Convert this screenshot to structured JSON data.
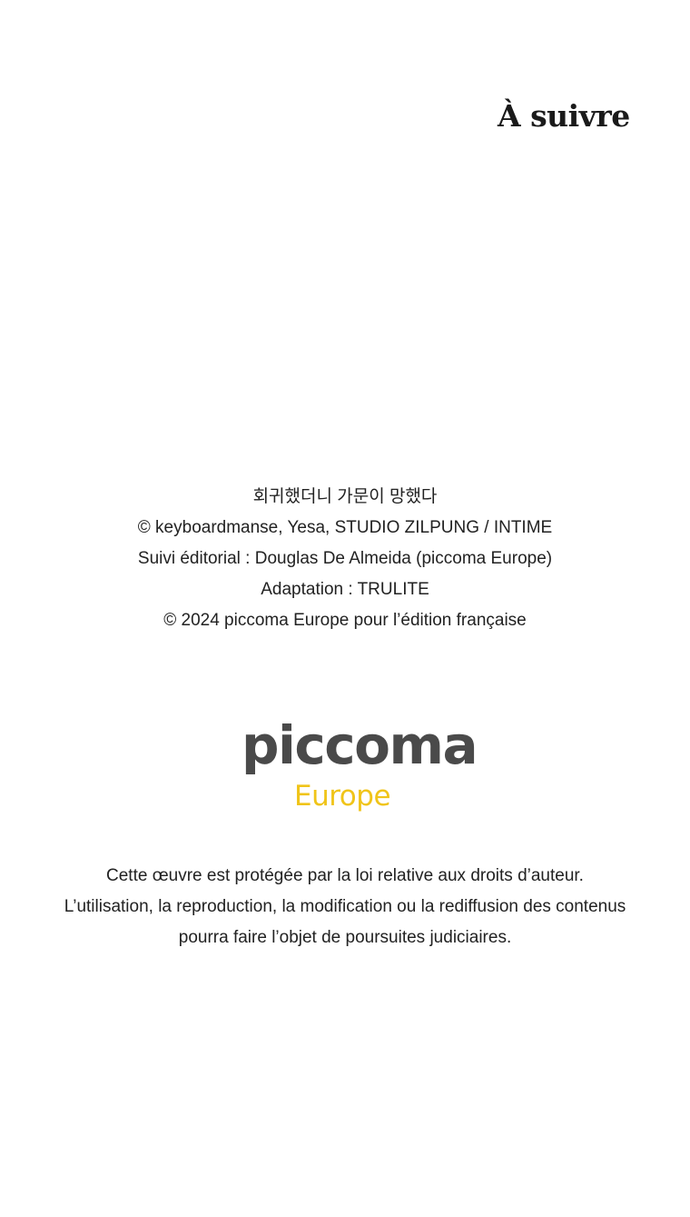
{
  "header": {
    "to_be_continued": "À suivre"
  },
  "credits": {
    "lines": [
      "회귀했더니 가문이 망했다",
      "© keyboardmanse, Yesa, STUDIO ZILPUNG / INTIME",
      "Suivi éditorial : Douglas De Almeida (piccoma Europe)",
      "Adaptation : TRULITE",
      "© 2024 piccoma Europe pour l’édition française"
    ]
  },
  "logo": {
    "brand": "piccoma",
    "region": "Europe",
    "brand_color": "#4a4a4a",
    "region_color": "#f0c419"
  },
  "notice": {
    "lines": [
      "Cette œuvre est protégée par la loi relative aux droits d’auteur.",
      "L’utilisation, la reproduction, la modification ou la rediffusion des contenus",
      "pourra faire l’objet de poursuites judiciaires."
    ]
  }
}
